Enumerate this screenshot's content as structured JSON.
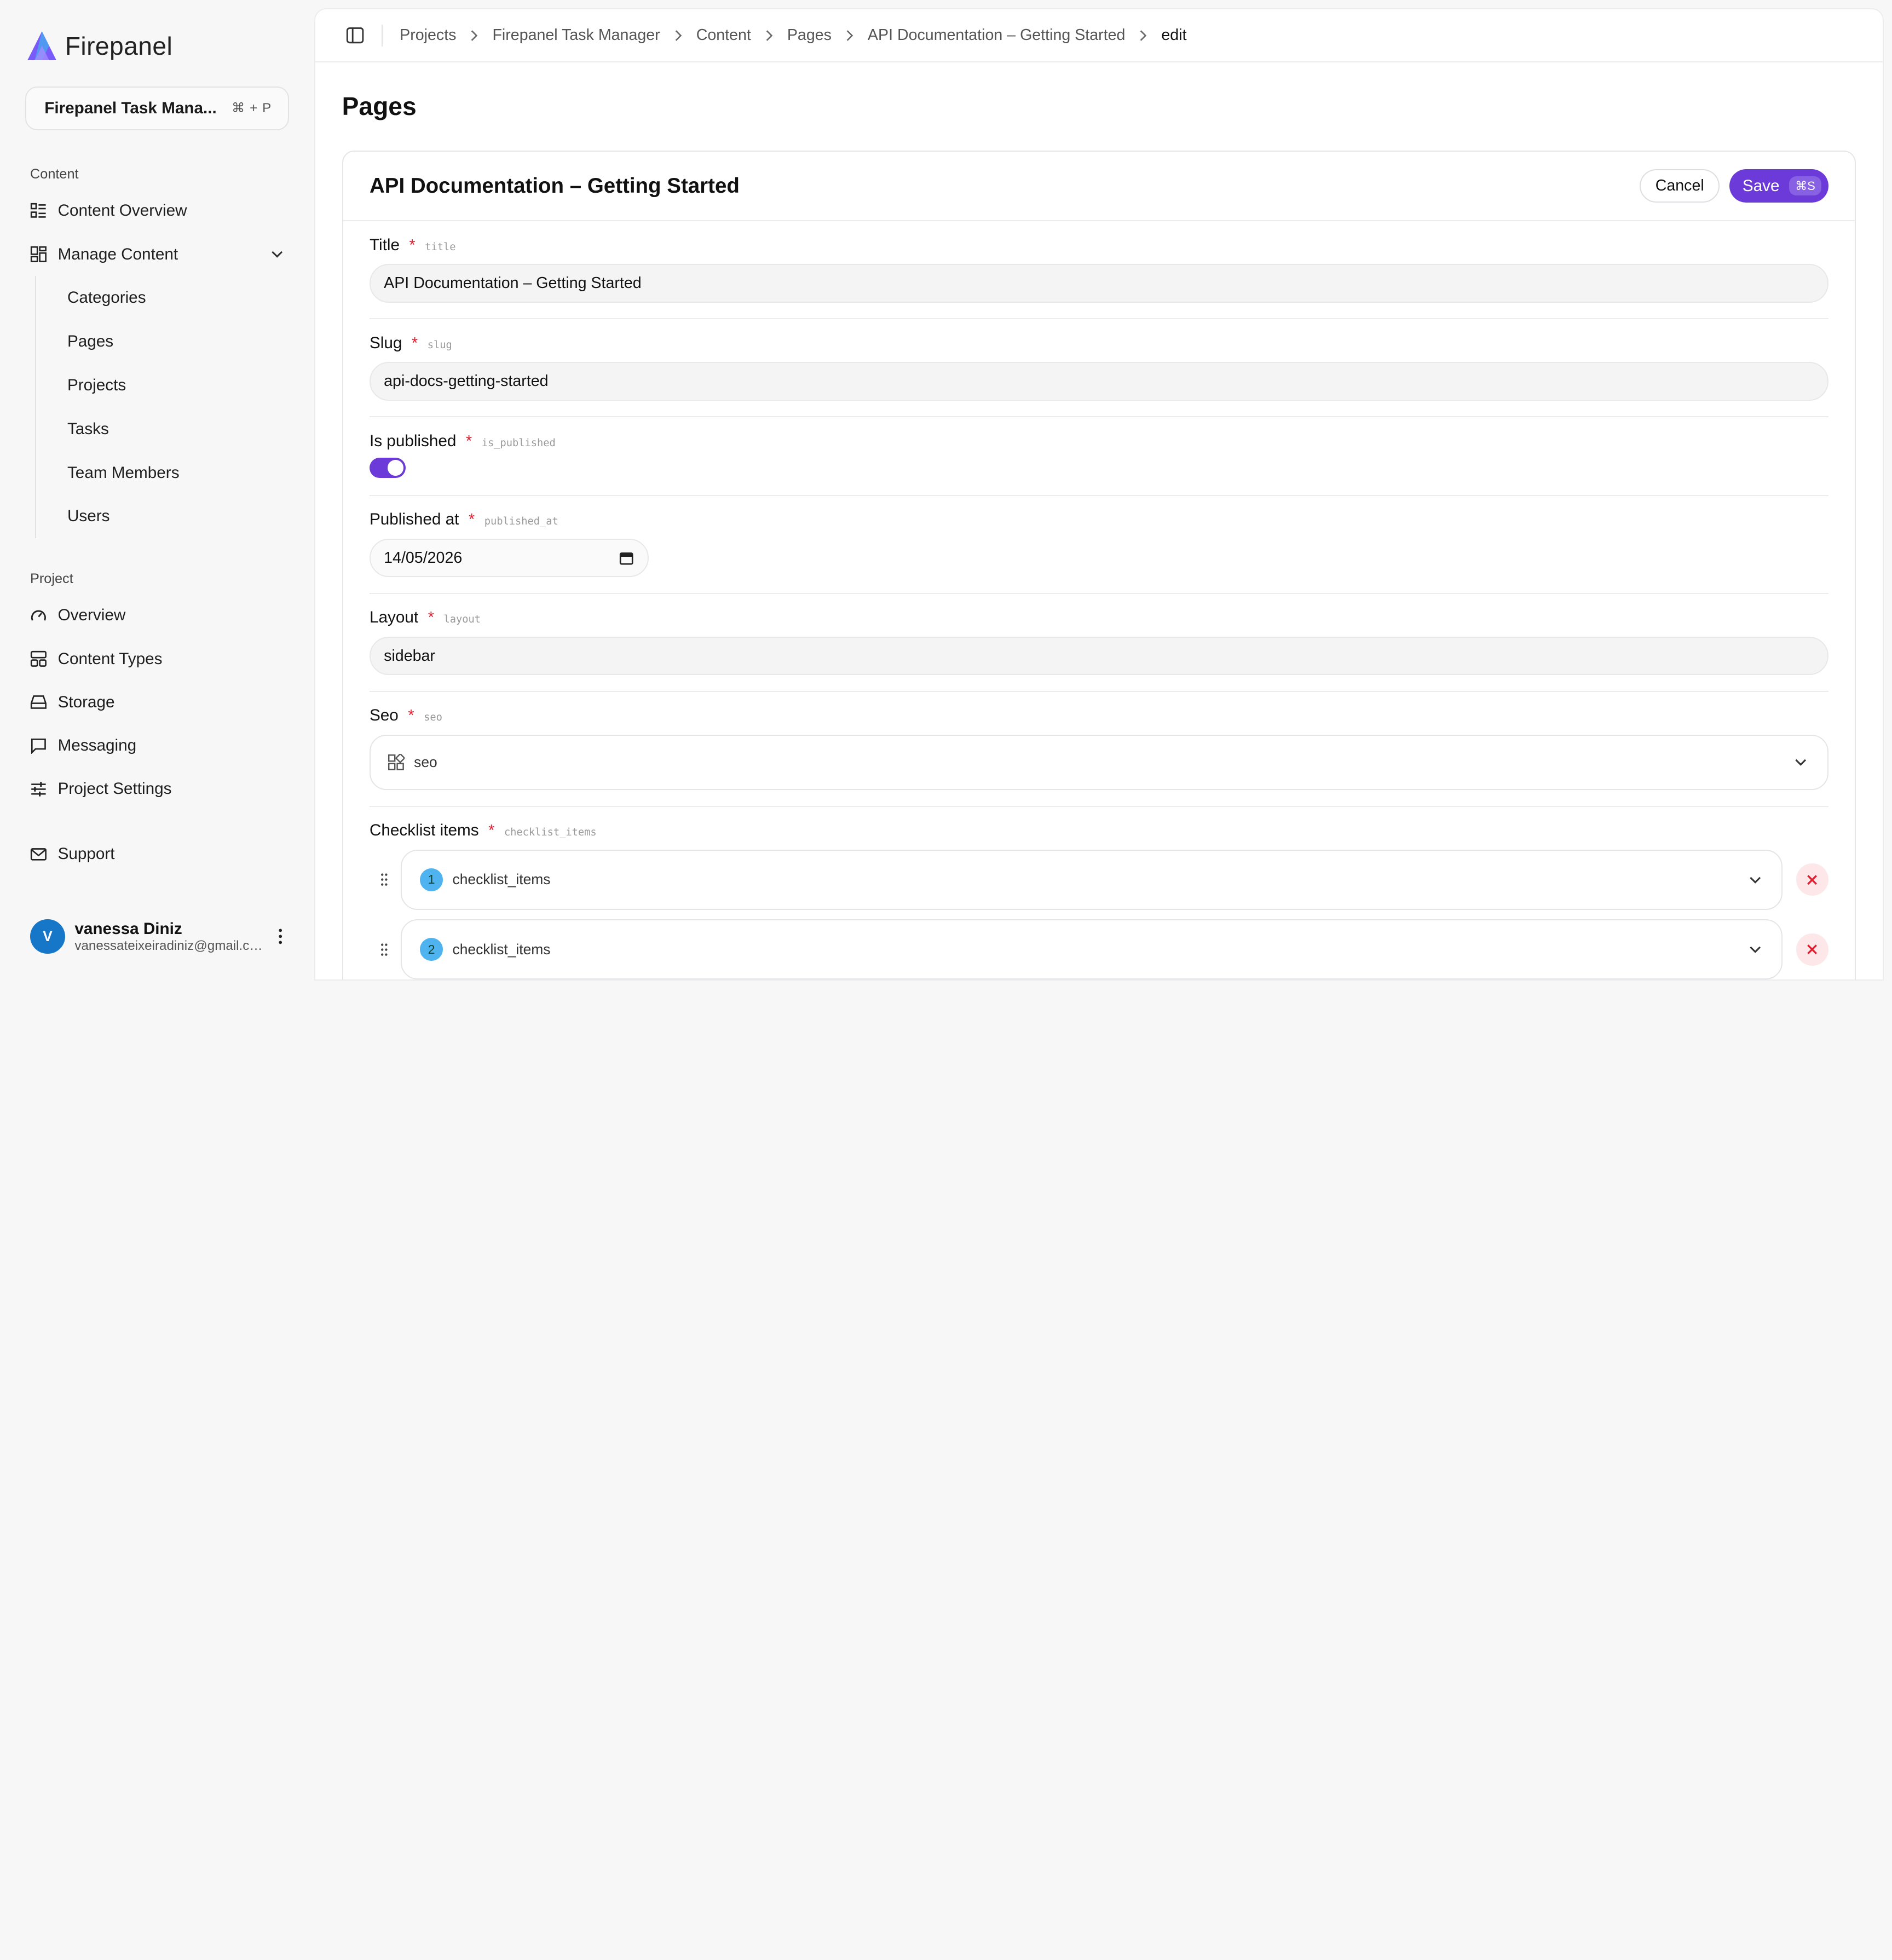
{
  "brand": {
    "name": "Firepanel"
  },
  "project_switcher": {
    "name": "Firepanel Task Mana...",
    "shortcut_cmd": "⌘",
    "shortcut_plus": "+",
    "shortcut_key": "P"
  },
  "sidebar": {
    "content_label": "Content",
    "content_overview": "Content Overview",
    "manage_content": "Manage Content",
    "sub_items": [
      "Categories",
      "Pages",
      "Projects",
      "Tasks",
      "Team Members",
      "Users"
    ],
    "project_label": "Project",
    "project_items": [
      "Overview",
      "Content Types",
      "Storage",
      "Messaging",
      "Project Settings"
    ],
    "support": "Support"
  },
  "user": {
    "initial": "V",
    "name": "vanessa Diniz",
    "email": "vanessateixeiradiniz@gmail.com"
  },
  "breadcrumbs": [
    "Projects",
    "Firepanel Task Manager",
    "Content",
    "Pages",
    "API Documentation – Getting Started",
    "edit"
  ],
  "page_title": "Pages",
  "editor": {
    "title": "API Documentation – Getting Started",
    "cancel": "Cancel",
    "save": "Save",
    "save_shortcut": "⌘S",
    "required_mark": "*",
    "fields": {
      "title": {
        "label": "Title",
        "key": "title",
        "value": "API Documentation – Getting Started"
      },
      "slug": {
        "label": "Slug",
        "key": "slug",
        "value": "api-docs-getting-started"
      },
      "is_published": {
        "label": "Is published",
        "key": "is_published",
        "value": true
      },
      "published_at": {
        "label": "Published at",
        "key": "published_at",
        "value": "14/05/2026"
      },
      "layout": {
        "label": "Layout",
        "key": "layout",
        "value": "sidebar"
      },
      "seo": {
        "label": "Seo",
        "key": "seo",
        "value": "seo"
      },
      "checklist_items": {
        "label": "Checklist items",
        "key": "checklist_items",
        "items": [
          {
            "index": "1",
            "label": "checklist_items"
          },
          {
            "index": "2",
            "label": "checklist_items"
          }
        ]
      }
    }
  },
  "colors": {
    "accent": "#6c3ad8",
    "badge": "#4fb3f0",
    "required": "#e11d2e",
    "avatar": "#1677c9"
  }
}
